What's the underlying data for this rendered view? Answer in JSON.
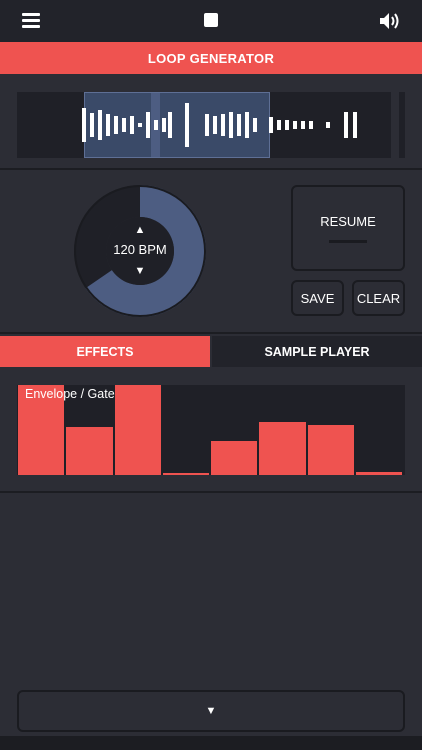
{
  "topbar": {
    "menu_icon": "hamburger-icon",
    "stop_icon": "stop-icon",
    "sound_icon": "speaker-icon"
  },
  "header": {
    "title": "LOOP GENERATOR"
  },
  "controls": {
    "bpm_label": "120 BPM",
    "up_glyph": "▲",
    "down_glyph": "▼",
    "resume_label": "RESUME",
    "save_label": "SAVE",
    "clear_label": "CLEAR"
  },
  "tabs": [
    {
      "label": "EFFECTS",
      "active": true
    },
    {
      "label": "SAMPLE PLAYER",
      "active": false
    }
  ],
  "envelope": {
    "title": "Envelope / Gate",
    "levels": [
      1.0,
      0.53,
      1.0,
      0.0,
      0.38,
      0.59,
      0.56,
      0.03
    ]
  },
  "expand_glyph": "▼",
  "colors": {
    "accent": "#ef5350",
    "selection": "#3a4a68",
    "background": "#2c2d35"
  }
}
